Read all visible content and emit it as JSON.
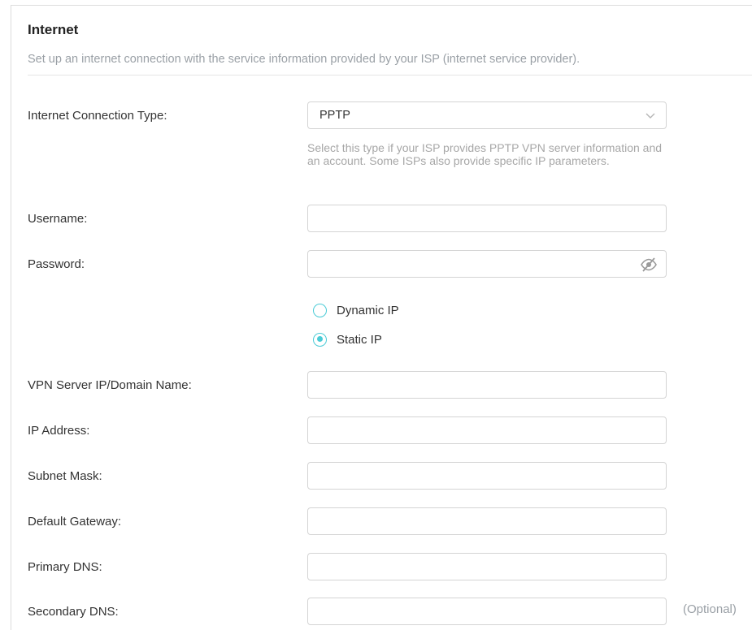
{
  "section": {
    "title": "Internet",
    "description": "Set up an internet connection with the service information provided by your ISP (internet service provider)."
  },
  "form": {
    "connection_type": {
      "label": "Internet Connection Type:",
      "value": "PPTP",
      "hint": "Select this type if your ISP provides PPTP VPN server information and an account. Some ISPs also provide specific IP parameters."
    },
    "username": {
      "label": "Username:",
      "value": ""
    },
    "password": {
      "label": "Password:",
      "value": ""
    },
    "ip_mode": {
      "options": [
        {
          "label": "Dynamic IP",
          "selected": false
        },
        {
          "label": "Static IP",
          "selected": true
        }
      ]
    },
    "vpn_server": {
      "label": "VPN Server IP/Domain Name:",
      "value": ""
    },
    "ip_address": {
      "label": "IP Address:",
      "value": ""
    },
    "subnet_mask": {
      "label": "Subnet Mask:",
      "value": ""
    },
    "default_gateway": {
      "label": "Default Gateway:",
      "value": ""
    },
    "primary_dns": {
      "label": "Primary DNS:",
      "value": ""
    },
    "secondary_dns": {
      "label": "Secondary DNS:",
      "value": "",
      "note": "(Optional)"
    }
  },
  "icons": {
    "dropdown": "chevron-down-icon",
    "password_toggle": "eye-off-icon"
  },
  "colors": {
    "accent": "#4acbd6",
    "hint_text": "#a7a7a7",
    "border": "#d4d4d4"
  }
}
